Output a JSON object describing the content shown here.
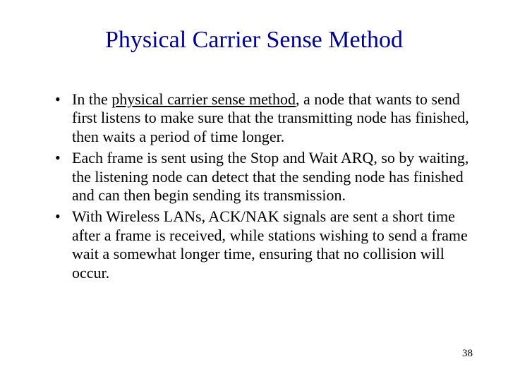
{
  "title": "Physical Carrier Sense Method",
  "bullets": {
    "b1_prefix": "In the ",
    "b1_underline": "physical carrier sense method",
    "b1_rest": ", a node that wants to send first listens to make sure that the transmitting node has finished, then waits a period of time longer.",
    "b2": "Each frame is sent using the Stop and Wait ARQ, so by waiting, the listening node can detect that the sending node has finished and can then begin sending its transmission.",
    "b3": "With Wireless LANs, ACK/NAK signals are sent a short time after a frame is received, while stations wishing to send a frame wait a somewhat longer time, ensuring that no collision will occur."
  },
  "marker": "•",
  "page_number": "38"
}
